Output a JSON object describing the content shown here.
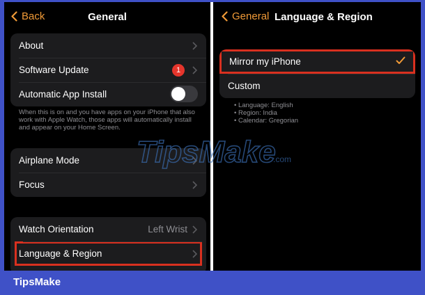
{
  "left_screen": {
    "back_label": "Back",
    "title": "General",
    "group1": {
      "about": "About",
      "software_update": "Software Update",
      "software_update_badge": "1",
      "automatic_app_install": "Automatic App Install"
    },
    "footnote": "When this is on and you have apps on your iPhone that also work with Apple Watch, those apps will automatically install and appear on your Home Screen.",
    "group2": {
      "airplane_mode": "Airplane Mode",
      "focus": "Focus"
    },
    "group3": {
      "watch_orientation": "Watch Orientation",
      "watch_orientation_value": "Left Wrist",
      "language_region": "Language & Region"
    }
  },
  "right_screen": {
    "back_label": "General",
    "title": "Language & Region",
    "options": {
      "mirror": "Mirror my iPhone",
      "custom": "Custom"
    },
    "info": [
      "• Language: English",
      "• Region: India",
      "• Calendar: Gregorian"
    ]
  },
  "watermark_text": "TipsMake",
  "watermark_suffix": ".com",
  "footer_brand": "TipsMake",
  "colors": {
    "accent_orange": "#f09a37",
    "highlight_red": "#d9301f",
    "badge_red": "#e5352c",
    "border_blue": "#3f51c7"
  }
}
